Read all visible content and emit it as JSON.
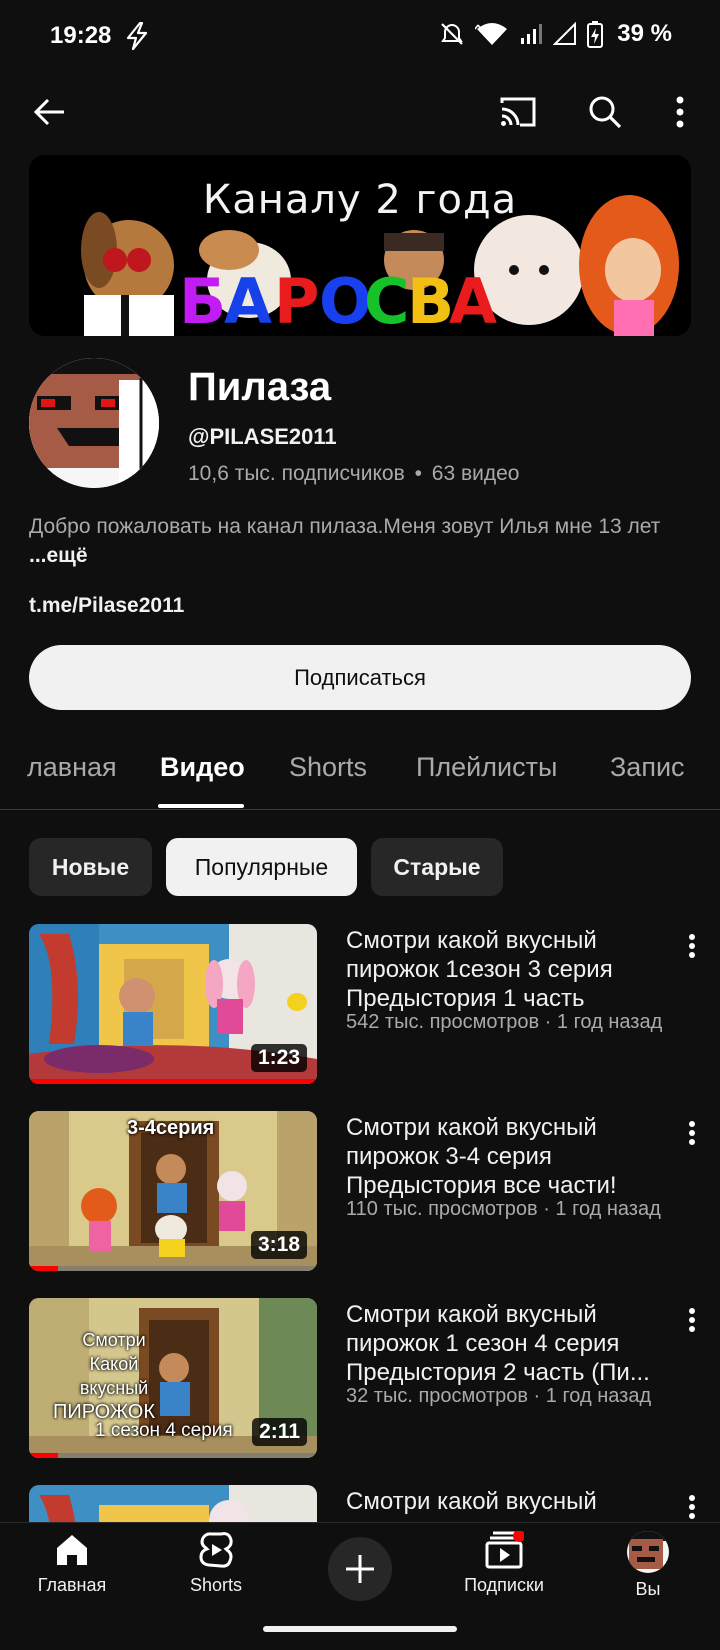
{
  "status": {
    "time": "19:28",
    "battery": "39 %"
  },
  "channel": {
    "banner_title": "Каналу 2 года",
    "banner_logo_text": "БАРОСВАН",
    "name": "Пилаза",
    "handle": "@PILASE2011",
    "subscribers": "10,6 тыс. подписчиков",
    "separator": "•",
    "videos_count": "63 видео",
    "description": "Добро пожаловать на канал пилаза.Меня зовут Илья мне 13 лет",
    "more": "...ещё",
    "link": "t.me/Pilase2011",
    "subscribe_label": "Подписаться"
  },
  "tabs": [
    {
      "label": "Главная",
      "visible_text": "лавная"
    },
    {
      "label": "Видео",
      "active": true
    },
    {
      "label": "Shorts"
    },
    {
      "label": "Плейлисты"
    },
    {
      "label": "Записи",
      "visible_text": "Запис"
    }
  ],
  "chips": [
    {
      "label": "Новые"
    },
    {
      "label": "Популярные",
      "active": true
    },
    {
      "label": "Старые"
    }
  ],
  "videos": [
    {
      "title": "Смотри какой вкусный пирожок 1сезон 3 серия Предыстория 1 часть",
      "meta": "542 тыс. просмотров · 1 год назад",
      "duration": "1:23",
      "watched_fraction": 1.0
    },
    {
      "title": "Смотри какой вкусный пирожок 3-4 серия Предыстория все части!",
      "meta": "110 тыс. просмотров · 1 год назад",
      "duration": "3:18",
      "overlay_text": "3-4серия",
      "watched_fraction": 0.1
    },
    {
      "title": "Смотри какой вкусный пирожок 1 сезон 4 серия Предыстория 2 часть (Пи...",
      "meta": "32 тыс. просмотров · 1 год назад",
      "duration": "2:11",
      "overlay_lines": [
        "Смотри",
        "Какой",
        "вкусный",
        "ПИРОЖОК",
        "1 сезон 4 серия"
      ],
      "watched_fraction": 0.1
    },
    {
      "title": "Смотри какой вкусный",
      "meta": "",
      "duration": ""
    }
  ],
  "nav": [
    {
      "label": "Главная",
      "icon": "home-icon"
    },
    {
      "label": "Shorts",
      "icon": "shorts-icon"
    },
    {
      "label": "",
      "icon": "create-icon"
    },
    {
      "label": "Подписки",
      "icon": "subscriptions-icon"
    },
    {
      "label": "Вы",
      "icon": "avatar"
    }
  ],
  "colors": {
    "background": "#0f0f0f",
    "primary_text": "#f1f1f1",
    "secondary_text": "#aaaaaa",
    "progress": "#ff0000",
    "chip_bg": "#272727"
  }
}
